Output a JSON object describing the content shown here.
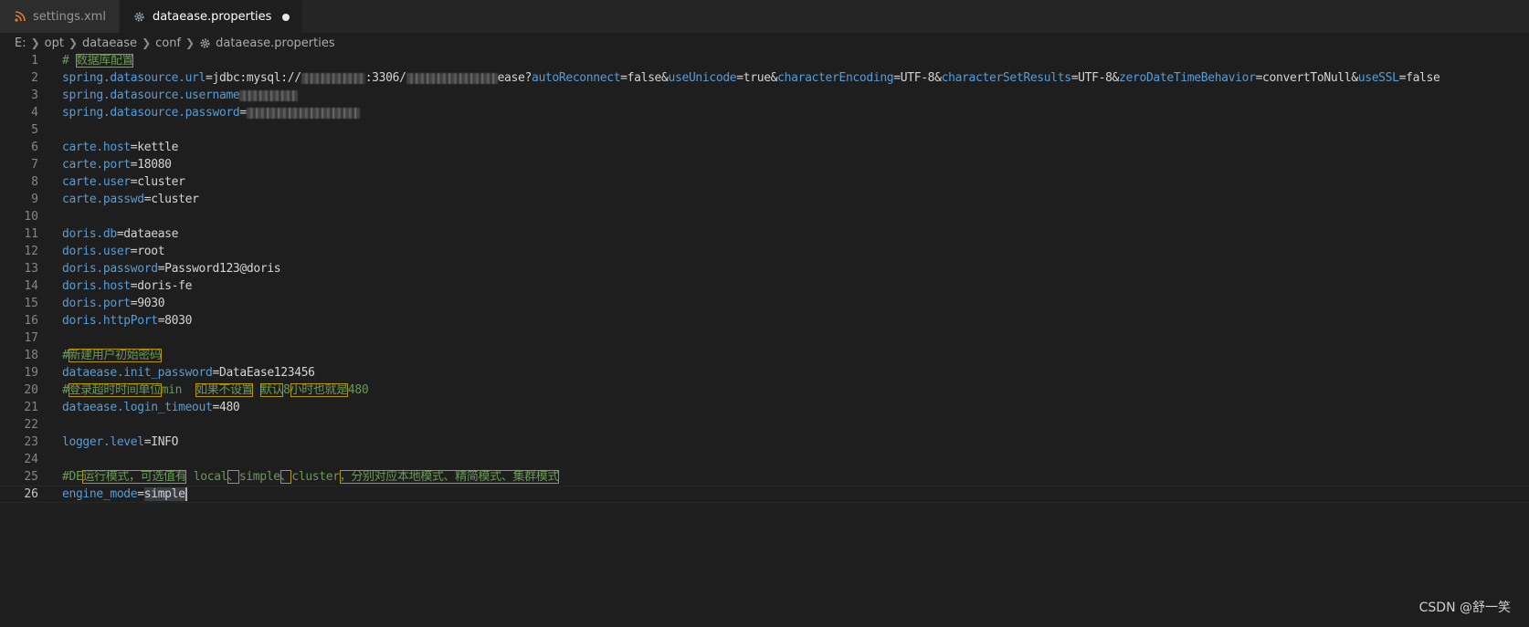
{
  "tabs": [
    {
      "label": "settings.xml",
      "icon": "rss-icon",
      "active": false
    },
    {
      "label": "dataease.properties",
      "icon": "gear-icon",
      "active": true,
      "dirty": true
    }
  ],
  "breadcrumb": [
    "E:",
    "opt",
    "dataease",
    "conf",
    "dataease.properties"
  ],
  "lines": [
    {
      "n": "1",
      "parts": [
        [
          "c",
          "# "
        ],
        [
          "cj",
          "数据库配置"
        ]
      ]
    },
    {
      "n": "2",
      "parts": [
        [
          "k",
          "spring.datasource.url"
        ],
        [
          "v",
          "=jdbc:mysql://"
        ],
        [
          "blur",
          "70"
        ],
        [
          "v",
          ":3306/"
        ],
        [
          "blur",
          "100"
        ],
        [
          "v",
          "ease?"
        ],
        [
          "k",
          "autoReconnect"
        ],
        [
          "v",
          "=false&"
        ],
        [
          "k",
          "useUnicode"
        ],
        [
          "v",
          "=true&"
        ],
        [
          "k",
          "characterEncoding"
        ],
        [
          "v",
          "=UTF-8&"
        ],
        [
          "k",
          "characterSetResults"
        ],
        [
          "v",
          "=UTF-8&"
        ],
        [
          "k",
          "zeroDateTimeBehavior"
        ],
        [
          "v",
          "=convertToNull&"
        ],
        [
          "k",
          "useSSL"
        ],
        [
          "v",
          "=false"
        ]
      ]
    },
    {
      "n": "3",
      "parts": [
        [
          "k",
          "spring.datasource.username"
        ],
        [
          "blur",
          "64"
        ]
      ]
    },
    {
      "n": "4",
      "parts": [
        [
          "k",
          "spring.datasource.password"
        ],
        [
          "v",
          "="
        ],
        [
          "blur",
          "124"
        ]
      ]
    },
    {
      "n": "5",
      "parts": []
    },
    {
      "n": "6",
      "parts": [
        [
          "k",
          "carte.host"
        ],
        [
          "v",
          "=kettle"
        ]
      ]
    },
    {
      "n": "7",
      "parts": [
        [
          "k",
          "carte.port"
        ],
        [
          "v",
          "=18080"
        ]
      ]
    },
    {
      "n": "8",
      "parts": [
        [
          "k",
          "carte.user"
        ],
        [
          "v",
          "=cluster"
        ]
      ]
    },
    {
      "n": "9",
      "parts": [
        [
          "k",
          "carte.passwd"
        ],
        [
          "v",
          "=cluster"
        ]
      ]
    },
    {
      "n": "10",
      "parts": []
    },
    {
      "n": "11",
      "parts": [
        [
          "k",
          "doris.db"
        ],
        [
          "v",
          "=dataease"
        ]
      ]
    },
    {
      "n": "12",
      "parts": [
        [
          "k",
          "doris.user"
        ],
        [
          "v",
          "=root"
        ]
      ]
    },
    {
      "n": "13",
      "parts": [
        [
          "k",
          "doris.password"
        ],
        [
          "v",
          "=Password123@doris"
        ]
      ]
    },
    {
      "n": "14",
      "parts": [
        [
          "k",
          "doris.host"
        ],
        [
          "v",
          "=doris-fe"
        ]
      ]
    },
    {
      "n": "15",
      "parts": [
        [
          "k",
          "doris.port"
        ],
        [
          "v",
          "=9030"
        ]
      ]
    },
    {
      "n": "16",
      "parts": [
        [
          "k",
          "doris.httpPort"
        ],
        [
          "v",
          "=8030"
        ]
      ]
    },
    {
      "n": "17",
      "parts": []
    },
    {
      "n": "18",
      "parts": [
        [
          "c",
          "#"
        ],
        [
          "cj",
          "新建用户初始密码"
        ]
      ]
    },
    {
      "n": "19",
      "parts": [
        [
          "k",
          "dataease.init_password"
        ],
        [
          "v",
          "=DataEase123456"
        ]
      ]
    },
    {
      "n": "20",
      "parts": [
        [
          "c",
          "#"
        ],
        [
          "cj",
          "登录超时时间单位"
        ],
        [
          "c",
          "min  "
        ],
        [
          "cj",
          "如果不设置"
        ],
        [
          "c",
          " "
        ],
        [
          "cj",
          "默认"
        ],
        [
          "c",
          "8"
        ],
        [
          "cj",
          "小时也就是"
        ],
        [
          "c",
          "480"
        ]
      ]
    },
    {
      "n": "21",
      "parts": [
        [
          "k",
          "dataease.login_timeout"
        ],
        [
          "v",
          "=480"
        ]
      ]
    },
    {
      "n": "22",
      "parts": []
    },
    {
      "n": "23",
      "parts": [
        [
          "k",
          "logger.level"
        ],
        [
          "v",
          "=INFO"
        ]
      ]
    },
    {
      "n": "24",
      "parts": []
    },
    {
      "n": "25",
      "parts": [
        [
          "c",
          "#DE"
        ],
        [
          "cj",
          "运行模式，可选值有"
        ],
        [
          "c",
          " local"
        ],
        [
          "cj",
          "、"
        ],
        [
          "c",
          "simple"
        ],
        [
          "cj",
          "、"
        ],
        [
          "c",
          "cluster"
        ],
        [
          "cj",
          "，分别对应本地模式、精简模式、集群模式"
        ]
      ]
    },
    {
      "n": "26",
      "parts": [
        [
          "k",
          "engine_mode"
        ],
        [
          "v",
          "="
        ],
        [
          "sel",
          "simple"
        ],
        [
          "cursor",
          ""
        ]
      ],
      "current": true
    }
  ],
  "watermark": "CSDN @舒一笑",
  "colors": {
    "keyword": "#569cd6",
    "value": "#d4d4d4",
    "comment": "#6a9955",
    "highlight_border": "#b89500"
  }
}
